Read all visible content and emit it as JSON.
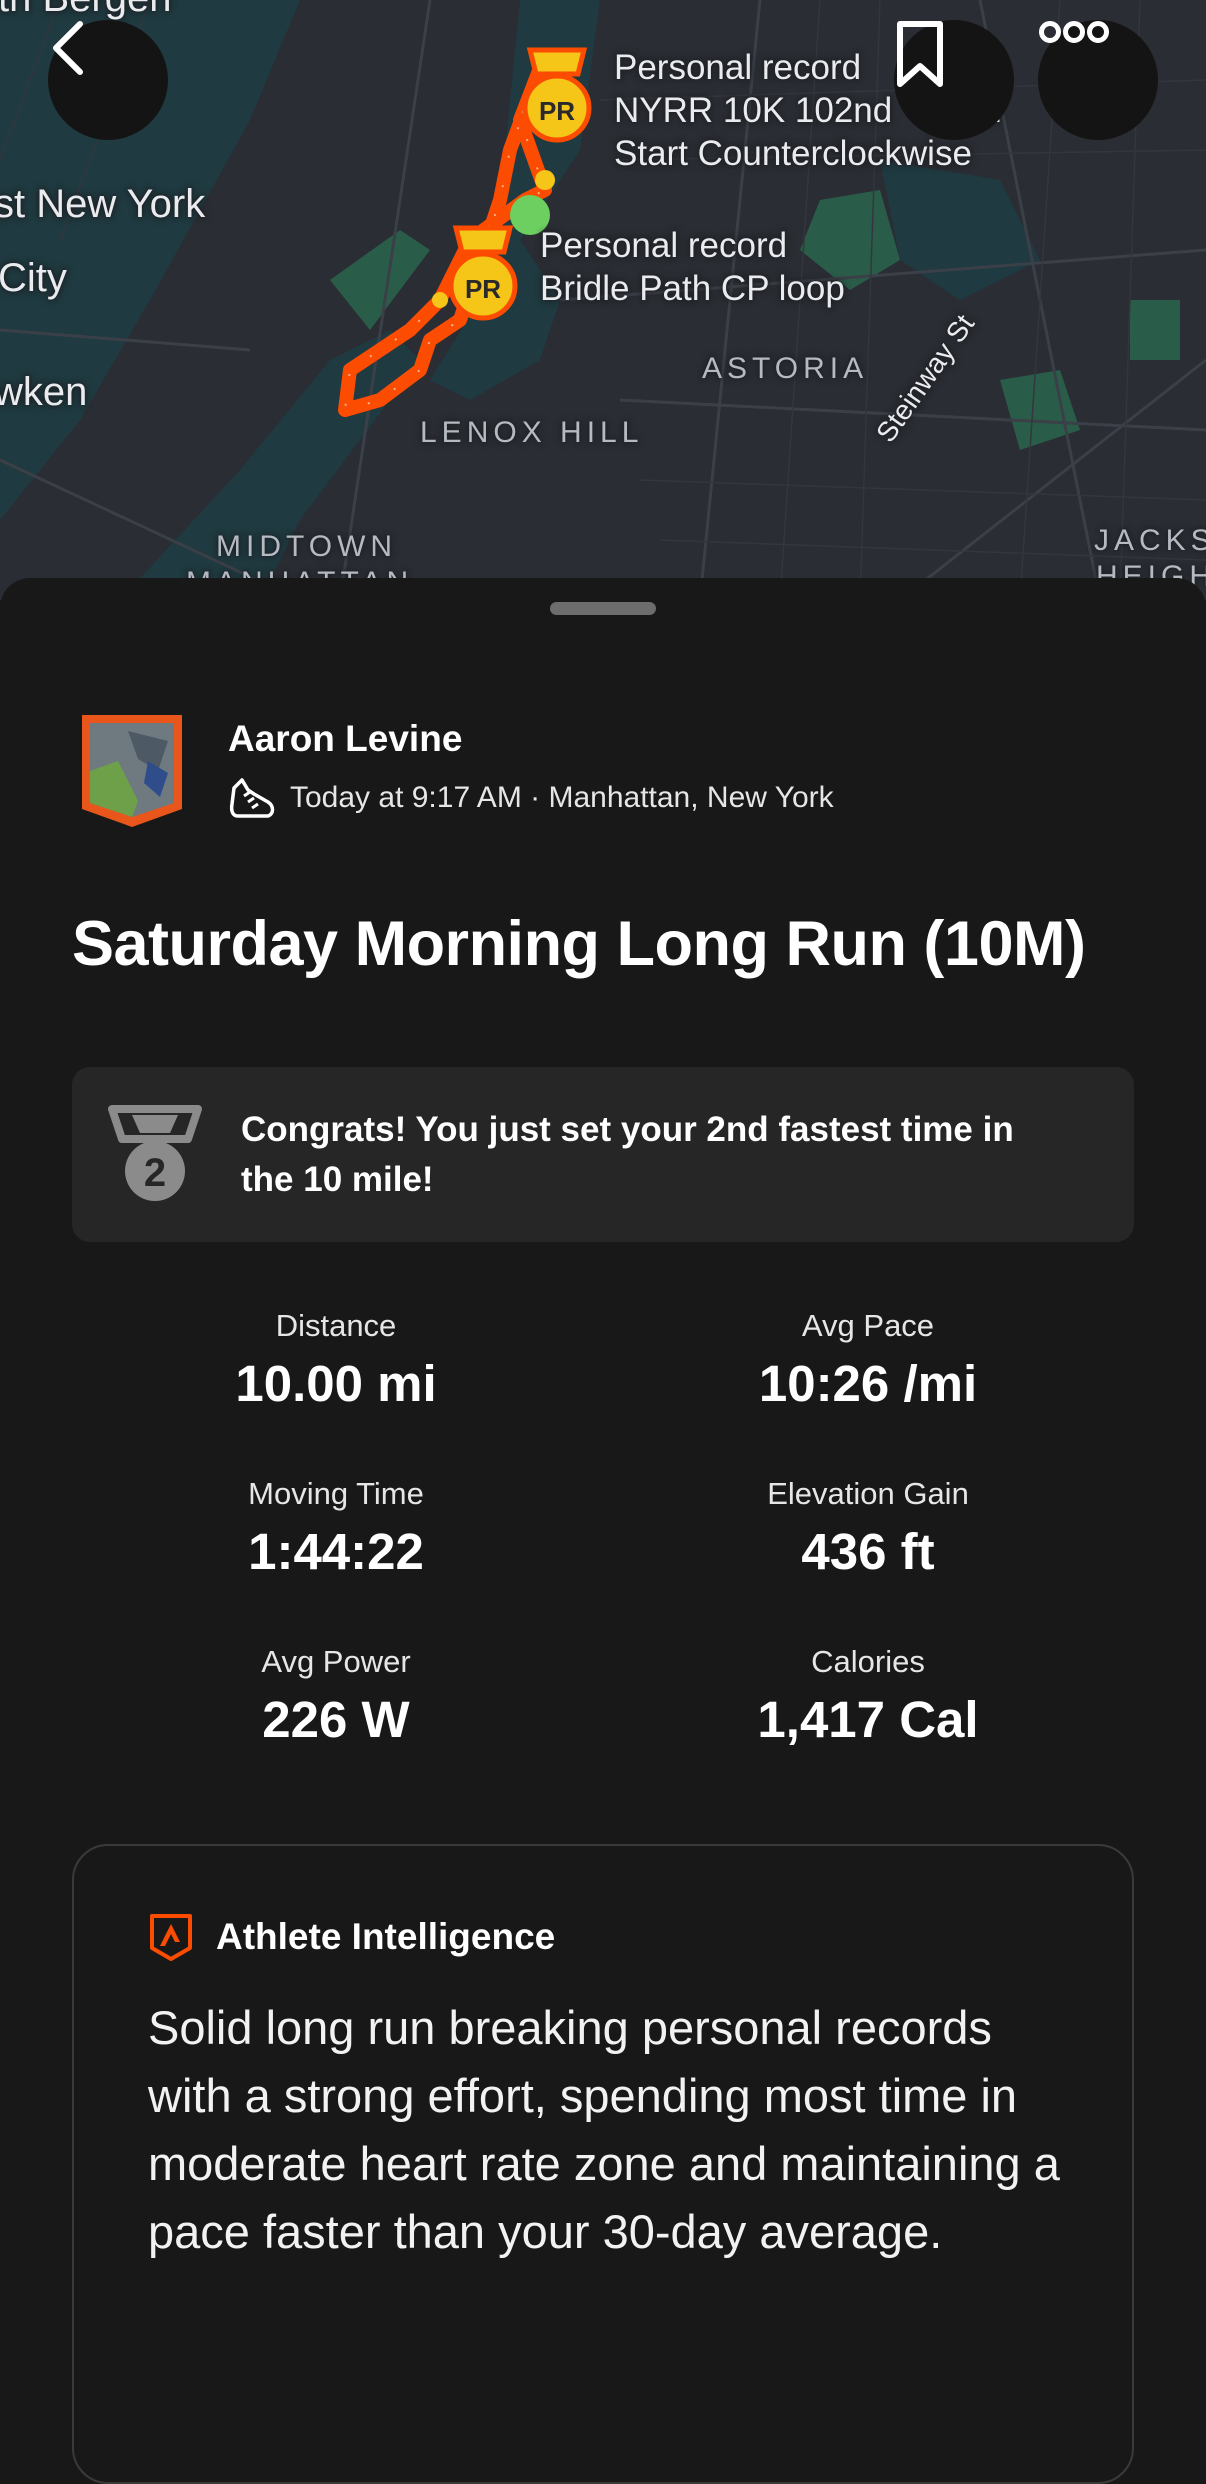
{
  "map": {
    "labels": {
      "top_left": "th Bergen",
      "west_new_york_1": "st New York",
      "west_new_york_2": "City",
      "weehawken": "wken",
      "astoria": "ASTORIA",
      "lenox_hill": "LENOX HILL",
      "midtown_1": "MIDTOWN",
      "midtown_2": "MANHATTAN",
      "steinway": "Steinway St",
      "jackson_1": "JACKS",
      "jackson_2": "HEIGH"
    },
    "pr_markers": [
      {
        "badge": "PR",
        "line1": "Personal record",
        "line2": "NYRR 10K 102nd",
        "line2_cut": "d",
        "line3": "Start Counterclockwise"
      },
      {
        "badge": "PR",
        "line1": "Personal record",
        "line2": "Bridle Path CP loop"
      }
    ],
    "colors": {
      "route": "#fc4c02",
      "pr_badge": "#f5c518",
      "start_dot": "#6ccf5f"
    }
  },
  "topbar": {
    "back_icon": "chevron-left-icon",
    "bookmark_icon": "bookmark-icon",
    "more_icon": "more-dots-icon"
  },
  "activity": {
    "athlete_name": "Aaron Levine",
    "activity_icon": "running-shoe-icon",
    "meta": "Today at 9:17 AM · Manhattan, New York",
    "title": "Saturday Morning Long Run (10M)"
  },
  "achievement": {
    "medal_number": "2",
    "text": "Congrats! You just set your 2nd fastest time in the 10 mile!"
  },
  "stats": [
    {
      "label": "Distance",
      "value": "10.00 mi"
    },
    {
      "label": "Avg Pace",
      "value": "10:26 /mi"
    },
    {
      "label": "Moving Time",
      "value": "1:44:22"
    },
    {
      "label": "Elevation Gain",
      "value": "436 ft"
    },
    {
      "label": "Avg Power",
      "value": "226 W"
    },
    {
      "label": "Calories",
      "value": "1,417 Cal"
    }
  ],
  "athlete_intelligence": {
    "icon": "athlete-intelligence-icon",
    "label": "Athlete Intelligence",
    "summary": "Solid long run breaking personal records with a strong effort, spending most time in moderate heart rate zone and maintaining a pace faster than your 30-day average."
  },
  "colors": {
    "accent": "#fc4c02",
    "background": "#181818",
    "card": "#262626"
  }
}
